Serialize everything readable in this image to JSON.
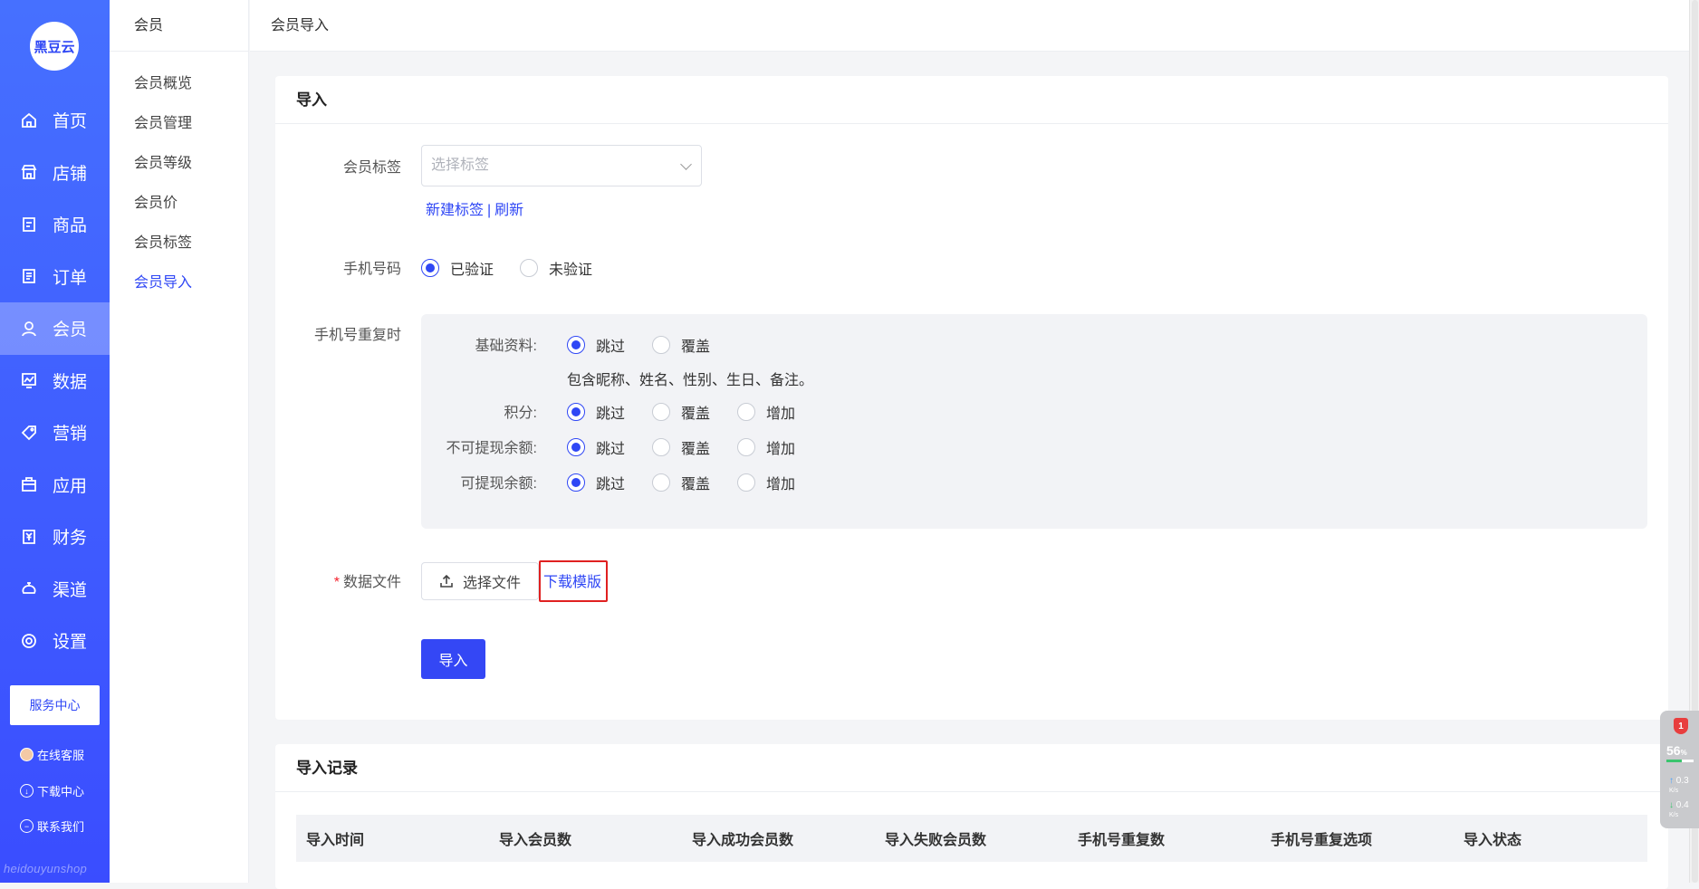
{
  "brand": {
    "logo_text": "黑豆云",
    "watermark": "heidouyunshop"
  },
  "sidebar": {
    "items": [
      {
        "label": "首页",
        "icon": "home-icon"
      },
      {
        "label": "店铺",
        "icon": "store-icon"
      },
      {
        "label": "商品",
        "icon": "goods-icon"
      },
      {
        "label": "订单",
        "icon": "order-icon"
      },
      {
        "label": "会员",
        "icon": "member-icon",
        "active": true
      },
      {
        "label": "数据",
        "icon": "chart-icon"
      },
      {
        "label": "营销",
        "icon": "tag-icon"
      },
      {
        "label": "应用",
        "icon": "app-icon"
      },
      {
        "label": "财务",
        "icon": "finance-icon"
      },
      {
        "label": "渠道",
        "icon": "channel-icon"
      },
      {
        "label": "设置",
        "icon": "gear-icon"
      }
    ],
    "service_center": "服务中心",
    "online_service": "在线客服",
    "download_center": "下载中心",
    "contact_us": "联系我们"
  },
  "subnav": {
    "title": "会员",
    "items": [
      "会员概览",
      "会员管理",
      "会员等级",
      "会员价",
      "会员标签",
      "会员导入"
    ],
    "active_index": 5
  },
  "topbar": {
    "breadcrumb": "会员导入"
  },
  "import_card": {
    "title": "导入",
    "member_tag": {
      "label": "会员标签",
      "placeholder": "选择标签",
      "new_tag": "新建标签",
      "separator": "|",
      "refresh": "刷新"
    },
    "phone": {
      "label": "手机号码",
      "options": [
        "已验证",
        "未验证"
      ],
      "selected": "已验证"
    },
    "duplicate": {
      "label": "手机号重复时",
      "basic": {
        "label": "基础资料:",
        "options": [
          "跳过",
          "覆盖"
        ],
        "selected": "跳过",
        "hint": "包含昵称、姓名、性别、生日、备注。"
      },
      "points": {
        "label": "积分:",
        "options": [
          "跳过",
          "覆盖",
          "增加"
        ],
        "selected": "跳过"
      },
      "non_withdrawable": {
        "label": "不可提现余额:",
        "options": [
          "跳过",
          "覆盖",
          "增加"
        ],
        "selected": "跳过"
      },
      "withdrawable": {
        "label": "可提现余额:",
        "options": [
          "跳过",
          "覆盖",
          "增加"
        ],
        "selected": "跳过"
      }
    },
    "data_file": {
      "required_mark": "*",
      "label": "数据文件",
      "choose_file": "选择文件",
      "download_template": "下载模版"
    },
    "import_button": "导入"
  },
  "records_card": {
    "title": "导入记录",
    "columns": [
      "导入时间",
      "导入会员数",
      "导入成功会员数",
      "导入失败会员数",
      "手机号重复数",
      "手机号重复选项",
      "导入状态"
    ]
  },
  "widget": {
    "badge": "1",
    "percent": "56",
    "percent_unit": "%",
    "up_speed": "0.3",
    "down_speed": "0.4",
    "speed_unit": "K/s"
  },
  "colors": {
    "primary": "#3447f5",
    "sidebar_top": "#4670ff",
    "highlight_border": "#e02020"
  }
}
